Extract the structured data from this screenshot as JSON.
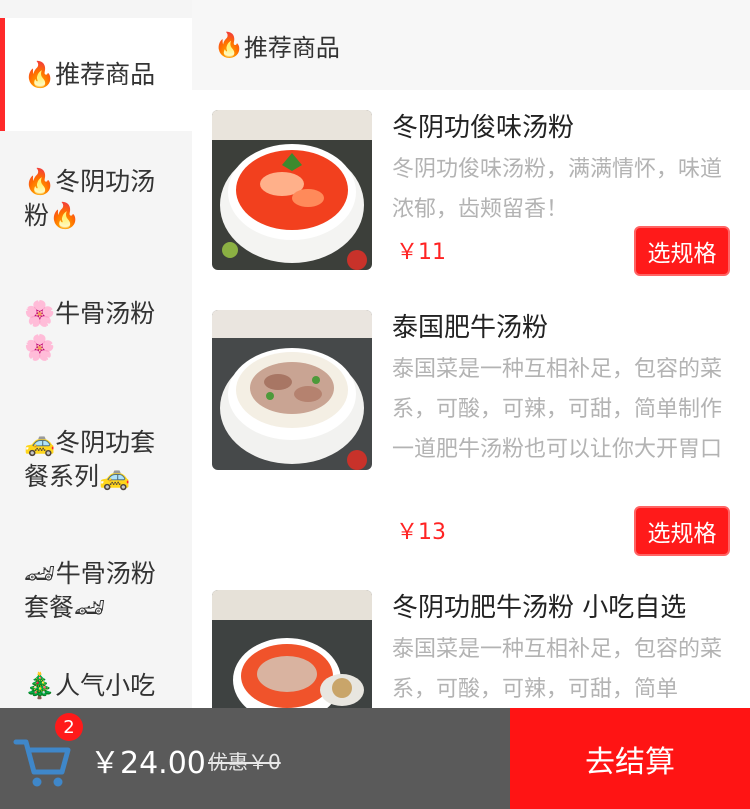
{
  "sidebar": {
    "items": [
      {
        "icon": "🔥",
        "label": "推荐商品",
        "trail": "",
        "active": true
      },
      {
        "icon": "🔥",
        "label": "冬阴功汤粉",
        "trail": "🔥",
        "active": false
      },
      {
        "icon": "🌸",
        "label": "牛骨汤粉",
        "trail": "🌸",
        "active": false
      },
      {
        "icon": "🚕",
        "label": "冬阴功套餐系列",
        "trail": "🚕",
        "active": false
      },
      {
        "icon": "🏎",
        "label": "牛骨汤粉套餐",
        "trail": "🏎",
        "active": false
      },
      {
        "icon": "🎄",
        "label": "人气小吃",
        "trail": "",
        "active": false
      }
    ]
  },
  "section": {
    "icon": "🔥",
    "title": "推荐商品"
  },
  "products": [
    {
      "name": "冬阴功俊味汤粉",
      "desc": "冬阴功俊味汤粉，满满情怀，味道浓郁，齿颊留香！",
      "price": "￥11",
      "button": "选规格"
    },
    {
      "name": "泰国肥牛汤粉",
      "desc": "泰国菜是一种互相补足，包容的菜系，可酸，可辣，可甜，简单制作一道肥牛汤粉也可以让你大开胃口",
      "price": "￥13",
      "button": "选规格"
    },
    {
      "name": "冬阴功肥牛汤粉 小吃自选",
      "desc": "泰国菜是一种互相补足，包容的菜系，可酸，可辣，可甜，简单"
    }
  ],
  "cart": {
    "count": "2",
    "total": "￥24.00",
    "discount": "优惠￥0",
    "checkout": "去结算"
  },
  "colors": {
    "accent": "#ff1a1a",
    "cart_bar": "#5a5a5a",
    "sidebar_bg": "#f5f5f5"
  }
}
